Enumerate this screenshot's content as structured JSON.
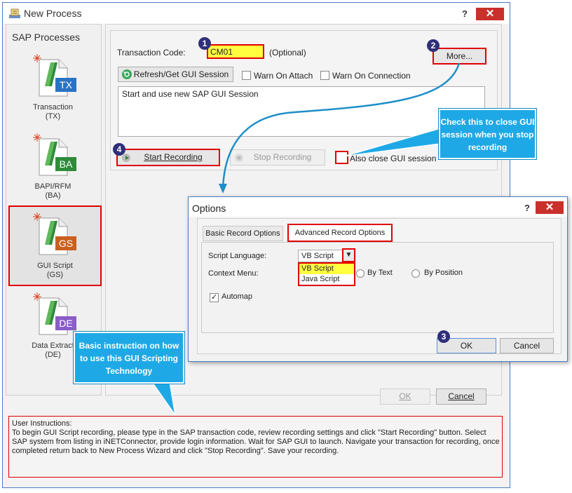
{
  "window": {
    "title": "New Process",
    "help": "?",
    "close": "✕"
  },
  "sidebar": {
    "title": "SAP Processes",
    "items": [
      {
        "badge": "TX",
        "color": "#2a73c3",
        "label": "Transaction",
        "sub": "(TX)"
      },
      {
        "badge": "BA",
        "color": "#2e8b3a",
        "label": "BAPI/RFM",
        "sub": "(BA)"
      },
      {
        "badge": "GS",
        "color": "#c9601e",
        "label": "GUI Script",
        "sub": "(GS)"
      },
      {
        "badge": "DE",
        "color": "#8a5cc8",
        "label": "Data Extract",
        "sub": "(DE)"
      }
    ]
  },
  "form": {
    "tcode_label": "Transaction Code:",
    "tcode_value": "CM01",
    "optional": "(Optional)",
    "more": "More...",
    "refresh": "Refresh/Get GUI Session",
    "warn_attach": "Warn On Attach",
    "warn_connection": "Warn On Connection",
    "session_text": "Start and use new SAP GUI Session",
    "start_recording": "Start Recording",
    "stop_recording": "Stop Recording",
    "also_close": "Also close GUI session",
    "ok": "OK",
    "cancel": "Cancel"
  },
  "numbers": {
    "n1": "1",
    "n2": "2",
    "n3": "3",
    "n4": "4"
  },
  "callouts": {
    "close_session": "Check this to close GUI session when you stop recording",
    "basic_instruction": "Basic instruction on how to use this GUI Scripting Technology"
  },
  "options": {
    "title": "Options",
    "help": "?",
    "close": "✕",
    "tab_basic": "Basic Record Options",
    "tab_advanced": "Advanced Record Options",
    "script_language_label": "Script Language:",
    "script_language_value": "VB Script",
    "languages": [
      "VB Script",
      "Java Script"
    ],
    "context_menu_label": "Context Menu:",
    "by_text": "By Text",
    "by_position": "By Position",
    "automap": "Automap",
    "ok": "OK",
    "cancel": "Cancel"
  },
  "instructions": {
    "title": "User Instructions:",
    "text": "To begin GUI Script recording, please type in the SAP transaction code, review recording settings and click \"Start Recording\" button. Select SAP system from listing in iNETConnector, provide login information. Wait for SAP GUI to launch. Navigate your transaction for recording, once completed return back to New Process Wizard and click \"Stop Recording\". Save your recording."
  }
}
